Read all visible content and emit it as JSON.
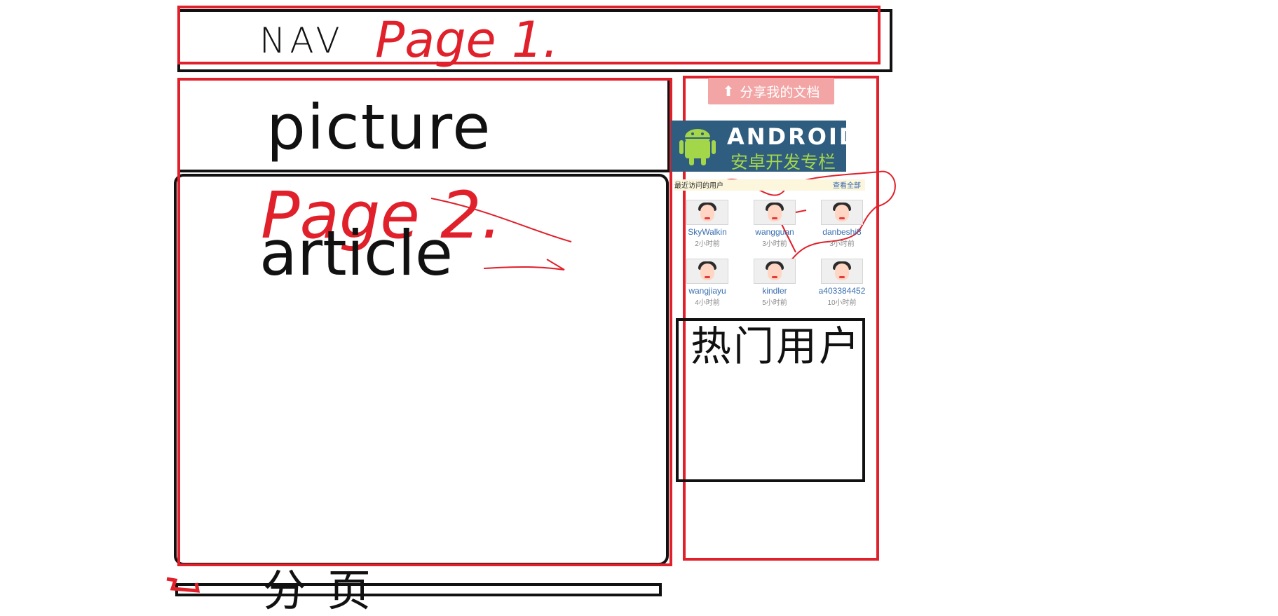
{
  "colors": {
    "ink_black": "#111111",
    "ink_red": "#e0202a",
    "banner_bg": "#2f5d7f",
    "banner_green": "#a4d64a",
    "share_pink": "#f3a5a5"
  },
  "labels": {
    "nav": "NAV",
    "page1": "Page 1.",
    "picture": "picture",
    "page2": "Page 2.",
    "article": "article",
    "hot_users": "热门用户",
    "pagination": "分页"
  },
  "sidebar": {
    "share_button": "分享我的文档",
    "share_icon": "upload-icon",
    "banner": {
      "title": "ANDROID",
      "subtitle": "安卓开发专栏",
      "icon": "android-robot-icon"
    },
    "recent_visitors": {
      "title": "最近访问的用户",
      "more": "查看全部"
    },
    "users": [
      {
        "name": "SkyWalkin",
        "time": "2小时前"
      },
      {
        "name": "wangguan",
        "time": "3小时前"
      },
      {
        "name": "danbeshi8",
        "time": "3小时前"
      },
      {
        "name": "wangjiayu",
        "time": "4小时前"
      },
      {
        "name": "kindler",
        "time": "5小时前"
      },
      {
        "name": "a403384452",
        "time": "10小时前"
      }
    ]
  }
}
